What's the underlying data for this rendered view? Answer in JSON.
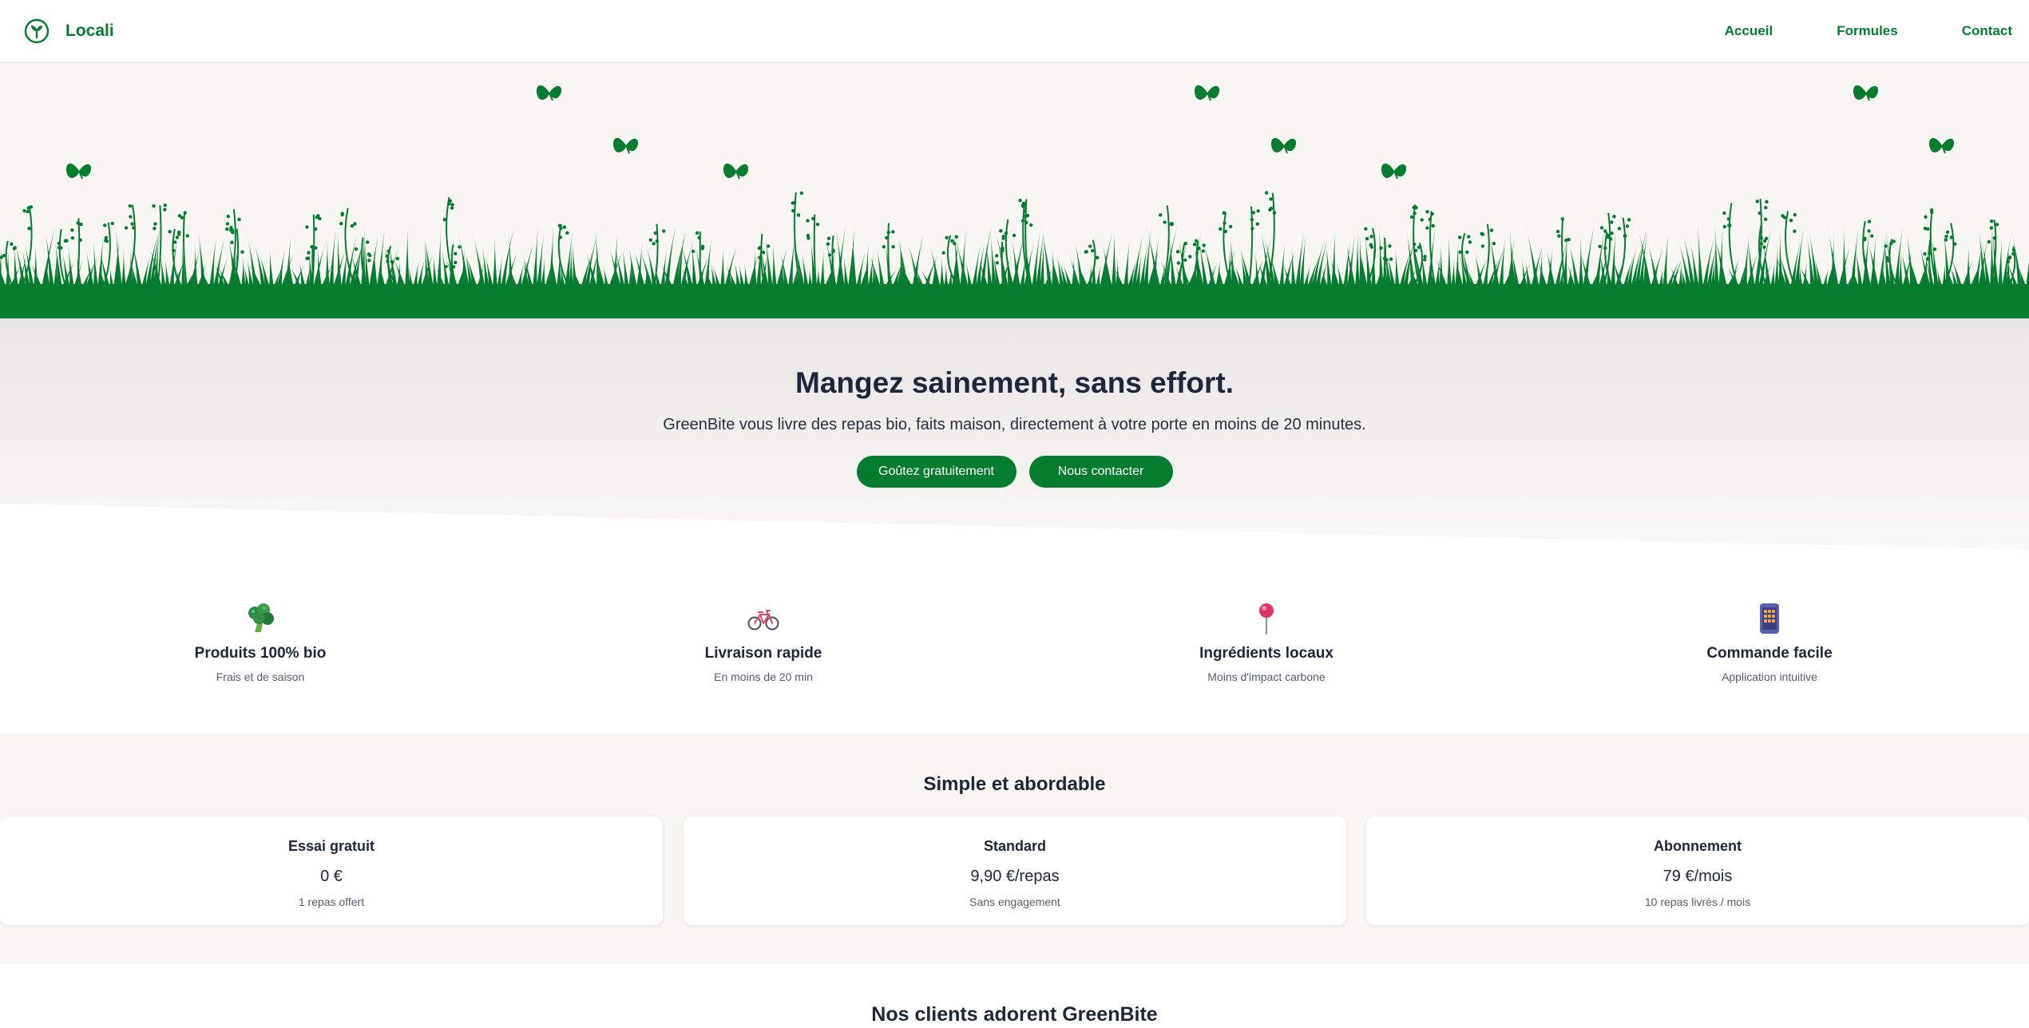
{
  "brand": {
    "name": "Locali",
    "color": "#067c31"
  },
  "nav": {
    "links": [
      "Accueil",
      "Formules",
      "Contact"
    ]
  },
  "hero": {
    "title": "Mangez sainement, sans effort.",
    "subtitle": "GreenBite vous livre des repas bio, faits maison, directement à votre porte en moins de 20 minutes.",
    "primary_button": "Goûtez gratuitement",
    "secondary_button": "Nous contacter"
  },
  "features": [
    {
      "icon": "broccoli-icon",
      "title": "Produits 100% bio",
      "subtitle": "Frais et de saison"
    },
    {
      "icon": "bicycle-icon",
      "title": "Livraison rapide",
      "subtitle": "En moins de 20 min"
    },
    {
      "icon": "pin-icon",
      "title": "Ingrédients locaux",
      "subtitle": "Moins d'impact carbone"
    },
    {
      "icon": "phone-icon",
      "title": "Commande facile",
      "subtitle": "Application intuitive"
    }
  ],
  "pricing": {
    "title": "Simple et abordable",
    "plans": [
      {
        "name": "Essai gratuit",
        "price": "0 €",
        "note": "1 repas offert"
      },
      {
        "name": "Standard",
        "price": "9,90 €/repas",
        "note": "Sans engagement"
      },
      {
        "name": "Abonnement",
        "price": "79 €/mois",
        "note": "10 repas livrés / mois"
      }
    ]
  },
  "testimonials": {
    "title": "Nos clients adorent GreenBite"
  },
  "colors": {
    "accent": "#067c31",
    "heading": "#1d2739",
    "muted": "#555f6b",
    "section_bg": "#f8f7f3"
  }
}
